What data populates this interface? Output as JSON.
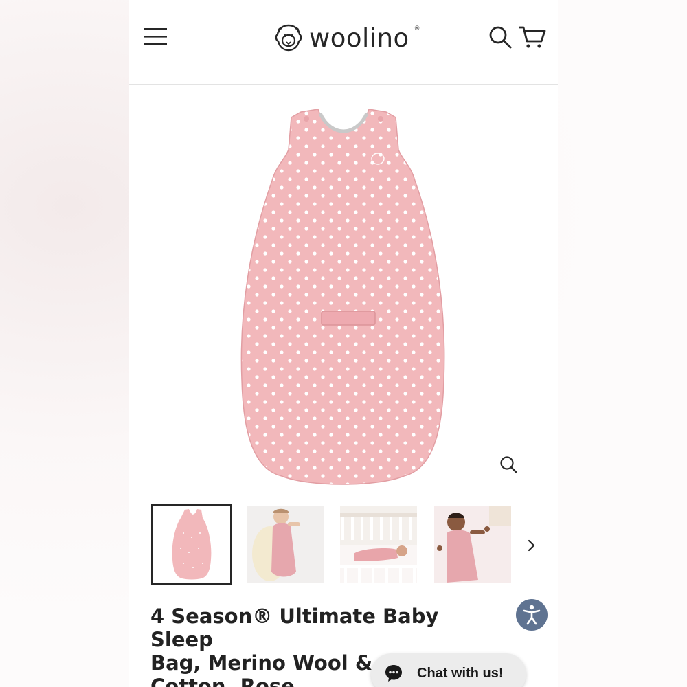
{
  "header": {
    "logo_text": "woolino",
    "logo_reg": "®",
    "icons": [
      "menu-icon",
      "search-icon",
      "cart-icon"
    ]
  },
  "product": {
    "main_image": "pink polka dot sleep bag",
    "zoom_icon": "zoom-icon",
    "thumbnails": [
      {
        "name": "thumb-sleep-bag",
        "active": true
      },
      {
        "name": "thumb-baby-sheepskin",
        "active": false
      },
      {
        "name": "thumb-baby-crib",
        "active": false
      },
      {
        "name": "thumb-baby-smiling",
        "active": false
      }
    ],
    "next_icon": "chevron-right-icon",
    "title_line1": "4 Season® Ultimate Baby Sleep",
    "title_line2": "Bag, Merino Wool & Organic",
    "title_line3": "Cotton, Rose"
  },
  "widgets": {
    "accessibility_icon": "accessibility-icon",
    "chat_label": "Chat with us!",
    "chat_icon": "chat-bubble-icon"
  },
  "colors": {
    "sleep_bag_pink": "#f2b8bb",
    "accessibility_blue": "#5f7391",
    "text_dark": "#222222"
  }
}
